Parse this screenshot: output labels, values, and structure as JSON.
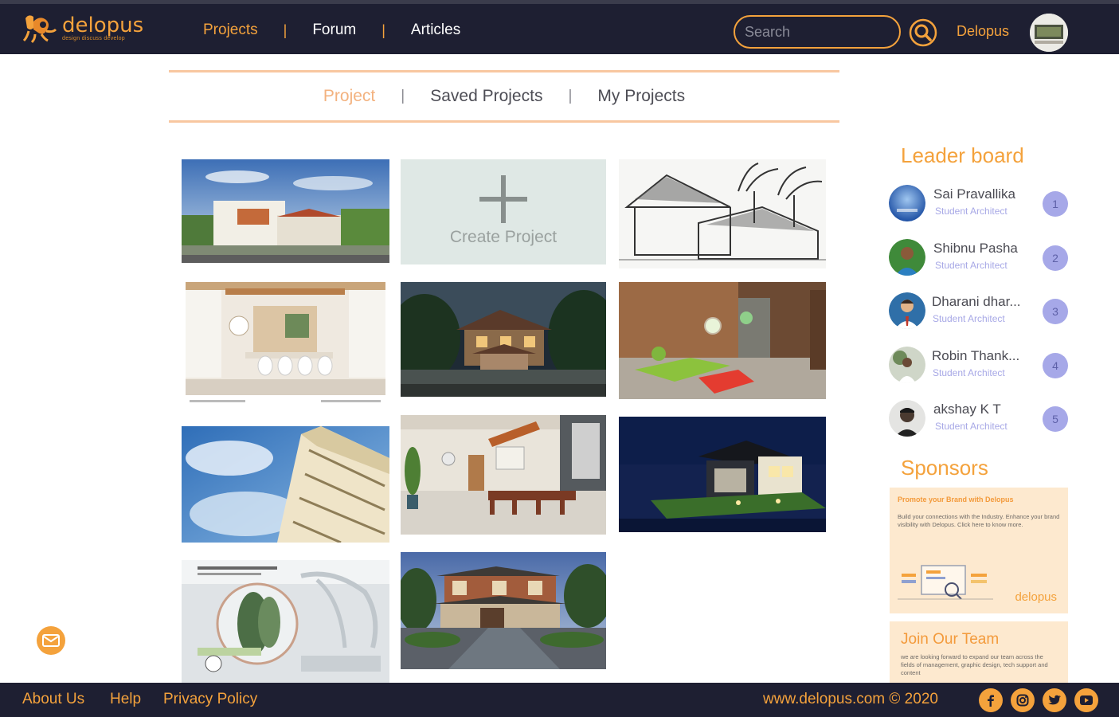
{
  "header": {
    "brand_name": "delopus",
    "brand_tagline": "design discuss develop",
    "nav": {
      "projects": "Projects",
      "forum": "Forum",
      "articles": "Articles",
      "separator": "|"
    },
    "search_placeholder": "Search",
    "user_name": "Delopus"
  },
  "subtabs": {
    "project": "Project",
    "saved": "Saved Projects",
    "mine": "My Projects",
    "separator": "|"
  },
  "grid": {
    "create_label": "Create Project"
  },
  "leaderboard": {
    "title": "Leader board",
    "entries": [
      {
        "name": "Sai Pravallika",
        "role": "Student Architect",
        "rank": "1"
      },
      {
        "name": "Shibnu Pasha",
        "role": "Student Architect",
        "rank": "2"
      },
      {
        "name": "Dharani dhar...",
        "role": "Student Architect",
        "rank": "3"
      },
      {
        "name": "Robin Thank...",
        "role": "Student Architect",
        "rank": "4"
      },
      {
        "name": "akshay K T",
        "role": "Student Architect",
        "rank": "5"
      }
    ]
  },
  "sponsors": {
    "title": "Sponsors",
    "card_heading": "Promote your Brand with Delopus",
    "card_text": "Build your connections with the Industry. Enhance your brand visibility with Delopus. Click here to know more.",
    "card_logo": "delopus"
  },
  "join": {
    "title": "Join Our Team",
    "text": "we are looking forward to expand our team across the fields of management, graphic design, tech support and content"
  },
  "footer": {
    "about": "About Us",
    "help": "Help",
    "privacy": "Privacy Policy",
    "copyright": "www.delopus.com © 2020"
  },
  "colors": {
    "accent": "#f4a23c",
    "navy": "#1e1f32",
    "rank_badge": "#a6a8e8"
  }
}
